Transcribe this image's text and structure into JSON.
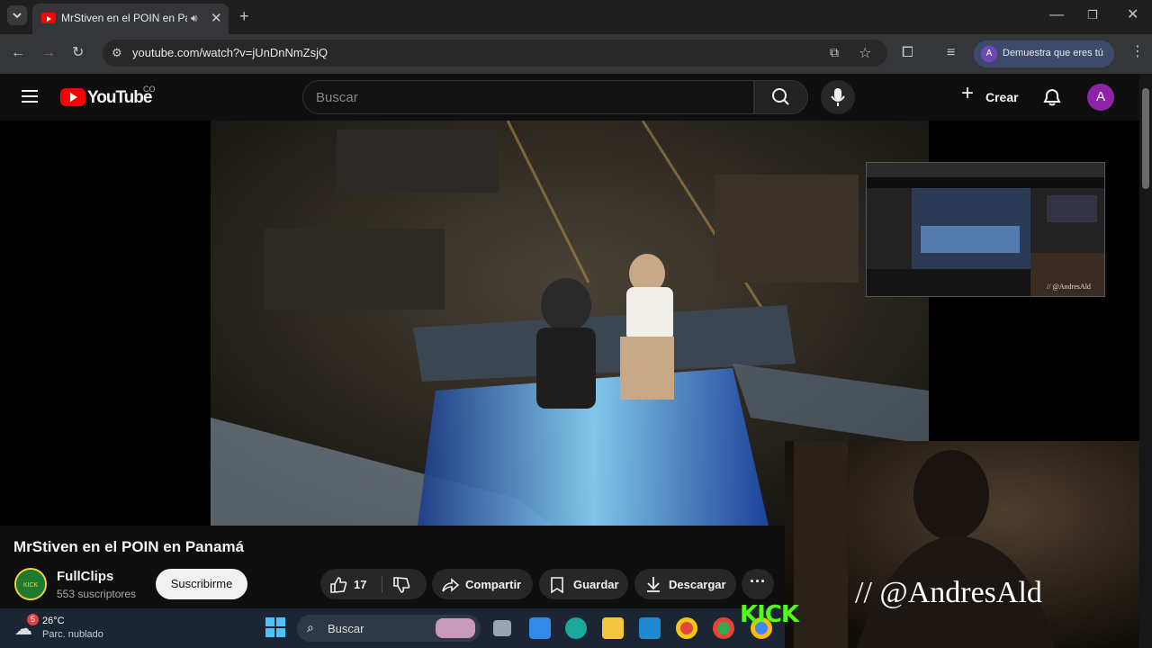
{
  "browser": {
    "tab_title": "MrStiven en el POIN en Panamá",
    "url": "youtube.com/watch?v=jUnDnNmZsjQ",
    "profile_label": "Demuestra que eres tú",
    "profile_initial": "A"
  },
  "youtube": {
    "logo_text": "YouTube",
    "region": "CO",
    "search_placeholder": "Buscar",
    "create_label": "Crear",
    "avatar_initial": "A"
  },
  "video": {
    "title": "MrStiven en el POIN en Panamá",
    "channel_name": "FullClips",
    "subscribers": "553 suscriptores",
    "subscribe_label": "Suscribirme",
    "likes": "17",
    "share_label": "Compartir",
    "save_label": "Guardar",
    "download_label": "Descargar"
  },
  "overlay": {
    "handle": "// @AndresAld",
    "kick_logo": "KICK"
  },
  "taskbar": {
    "weather_temp": "26°C",
    "weather_desc": "Parc. nublado",
    "weather_badge": "5",
    "search_label": "Buscar"
  },
  "colors": {
    "yt_red": "#ff0000",
    "kick_green": "#53fc18",
    "background": "#0f0f0f"
  }
}
